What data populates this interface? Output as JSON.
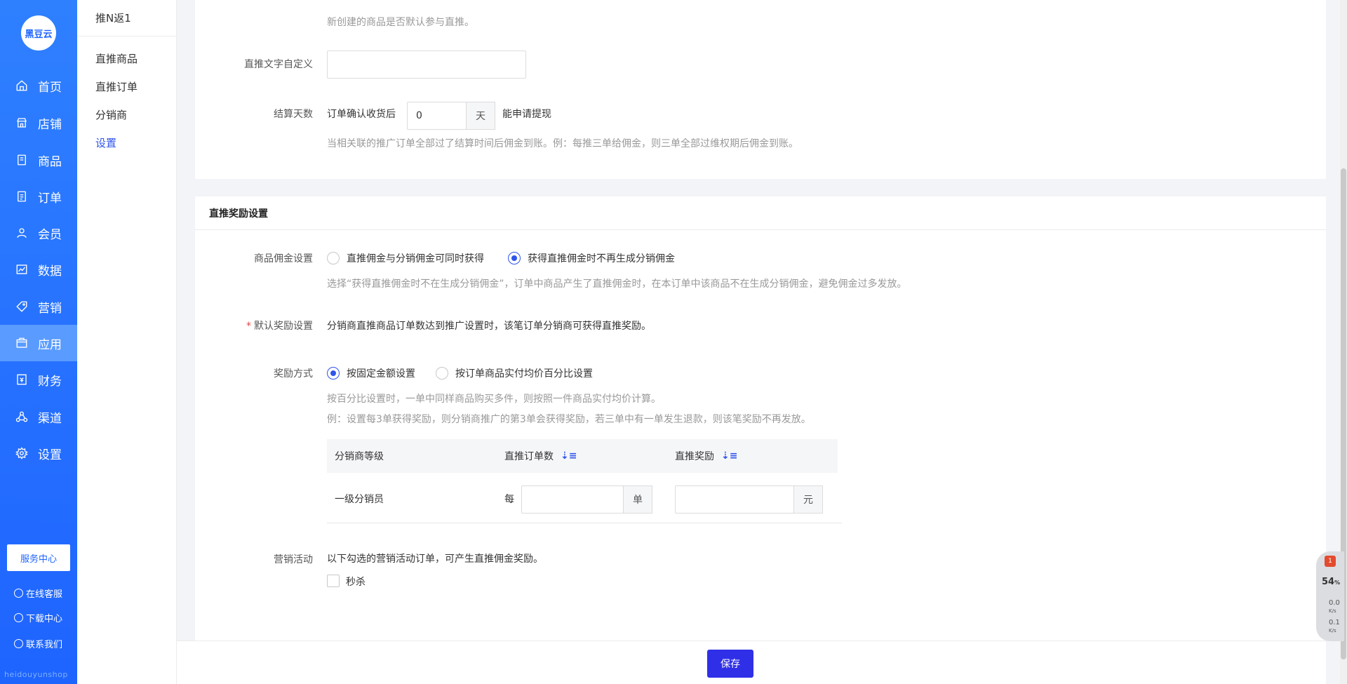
{
  "nav": {
    "logo": "黑豆云",
    "items": [
      {
        "label": "首页",
        "icon": "home-icon"
      },
      {
        "label": "店铺",
        "icon": "store-icon"
      },
      {
        "label": "商品",
        "icon": "goods-icon"
      },
      {
        "label": "订单",
        "icon": "order-icon"
      },
      {
        "label": "会员",
        "icon": "member-icon"
      },
      {
        "label": "数据",
        "icon": "chart-icon"
      },
      {
        "label": "营销",
        "icon": "tag-icon"
      },
      {
        "label": "应用",
        "icon": "app-icon"
      },
      {
        "label": "财务",
        "icon": "finance-icon"
      },
      {
        "label": "渠道",
        "icon": "channel-icon"
      },
      {
        "label": "设置",
        "icon": "gear-icon"
      }
    ],
    "active_index": 7,
    "service_center": "服务中心",
    "online_service": "在线客服",
    "download_center": "下载中心",
    "contact_us": "联系我们",
    "footer_text": "heidouyunshop"
  },
  "subnav": {
    "title": "推N返1",
    "items": [
      "直推商品",
      "直推订单",
      "分销商",
      "设置"
    ],
    "active_index": 3
  },
  "section1": {
    "default_hint": "新创建的商品是否默认参与直推。",
    "custom_text_label": "直推文字自定义",
    "custom_text_value": "",
    "settle_label": "结算天数",
    "settle_prefix": "订单确认收货后",
    "settle_value": "0",
    "settle_unit": "天",
    "settle_suffix": "能申请提现",
    "settle_hint": "当相关联的推广订单全部过了结算时间后佣金到账。例：每推三单给佣金，则三单全部过维权期后佣金到账。"
  },
  "section2": {
    "title": "直推奖励设置",
    "commission_label": "商品佣金设置",
    "commission_options": [
      "直推佣金与分销佣金可同时获得",
      "获得直推佣金时不再生成分销佣金"
    ],
    "commission_selected": 1,
    "commission_hint": "选择“获得直推佣金时不在生成分销佣金”，订单中商品产生了直推佣金时，在本订单中该商品不在生成分销佣金，避免佣金过多发放。",
    "default_reward_label": "默认奖励设置",
    "default_reward_required": "*",
    "default_reward_text": "分销商直推商品订单数达到推广设置时，该笔订单分销商可获得直推奖励。",
    "reward_mode_label": "奖励方式",
    "reward_mode_options": [
      "按固定金额设置",
      "按订单商品实付均价百分比设置"
    ],
    "reward_mode_selected": 0,
    "reward_hint1": "按百分比设置时，一单中同样商品购买多件，则按照一件商品实付均价计算。",
    "reward_hint2": "例：设置每3单获得奖励，则分销商推广的第3单会获得奖励，若三单中有一单发生退款，则该笔奖励不再发放。",
    "table": {
      "headers": [
        "分销商等级",
        "直推订单数",
        "直推奖励"
      ],
      "rows": [
        {
          "level": "一级分销员",
          "per": "每",
          "orders_value": "",
          "orders_unit": "单",
          "reward_value": "",
          "reward_unit": "元"
        }
      ]
    },
    "marketing_label": "营销活动",
    "marketing_text": "以下勾选的营销活动订单，可产生直推佣金奖励。",
    "marketing_option": "秒杀"
  },
  "footer": {
    "save_label": "保存"
  },
  "monitor": {
    "badge": "1",
    "percent": "54",
    "percent_unit": "%",
    "up": "0.0",
    "down": "0.1",
    "rate_unit": "K/s"
  }
}
